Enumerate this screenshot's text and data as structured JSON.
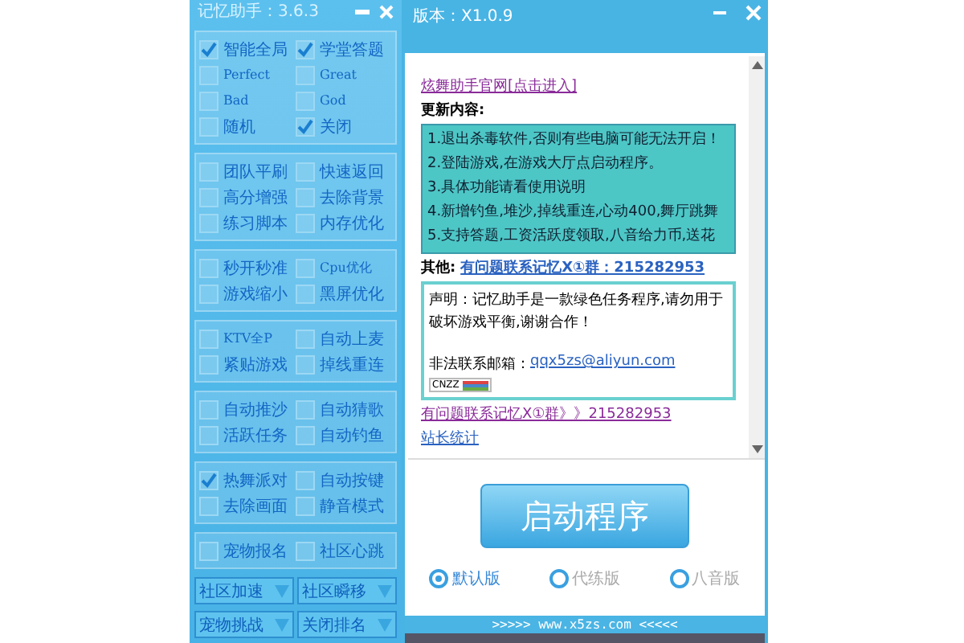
{
  "helper_panel": {
    "title": "记忆助手：3.6.3",
    "sections": [
      {
        "items": [
          {
            "label": "智能全局",
            "checked": true
          },
          {
            "label": "学堂答题",
            "checked": true
          },
          {
            "label": "Perfect",
            "checked": false
          },
          {
            "label": "Great",
            "checked": false
          },
          {
            "label": "Bad",
            "checked": false
          },
          {
            "label": "God",
            "checked": false
          },
          {
            "label": "随机",
            "checked": false
          },
          {
            "label": "关闭",
            "checked": true
          }
        ]
      },
      {
        "items": [
          {
            "label": "团队平刷",
            "checked": false
          },
          {
            "label": "快速返回",
            "checked": false
          },
          {
            "label": "高分增强",
            "checked": false
          },
          {
            "label": "去除背景",
            "checked": false
          },
          {
            "label": "练习脚本",
            "checked": false
          },
          {
            "label": "内存优化",
            "checked": false
          }
        ]
      },
      {
        "items": [
          {
            "label": "秒开秒准",
            "checked": false
          },
          {
            "label": "Cpu优化",
            "checked": false
          },
          {
            "label": "游戏缩小",
            "checked": false
          },
          {
            "label": "黑屏优化",
            "checked": false
          }
        ]
      },
      {
        "items": [
          {
            "label": "KTV全P",
            "checked": false
          },
          {
            "label": "自动上麦",
            "checked": false
          },
          {
            "label": "紧贴游戏",
            "checked": false
          },
          {
            "label": "掉线重连",
            "checked": false
          }
        ]
      },
      {
        "items": [
          {
            "label": "自动推沙",
            "checked": false
          },
          {
            "label": "自动猜歌",
            "checked": false
          },
          {
            "label": "活跃任务",
            "checked": false
          },
          {
            "label": "自动钓鱼",
            "checked": false
          }
        ]
      },
      {
        "items": [
          {
            "label": "热舞派对",
            "checked": true
          },
          {
            "label": "自动按键",
            "checked": false
          },
          {
            "label": "去除画面",
            "checked": false
          },
          {
            "label": "静音模式",
            "checked": false
          }
        ]
      },
      {
        "items": [
          {
            "label": "宠物报名",
            "checked": false
          },
          {
            "label": "社区心跳",
            "checked": false
          }
        ]
      }
    ],
    "dropdowns": [
      {
        "label": "社区加速"
      },
      {
        "label": "社区瞬移"
      },
      {
        "label": "宠物挑战"
      },
      {
        "label": "关闭排名"
      }
    ]
  },
  "main_window": {
    "title": "版本：X1.0.9",
    "site_link": "炫舞助手官网[点击进入]",
    "heading": "更新内容:",
    "updates": [
      "1.退出杀毒软件,否则有些电脑可能无法开启！",
      "2.登陆游戏,在游戏大厅点启动程序。",
      "3.具体功能请看使用说明",
      "4.新增钓鱼,堆沙,掉线重连,心动400,舞厅跳舞",
      "5.支持答题,工资活跃度领取,八音给力币,送花"
    ],
    "other_label": "其他:",
    "other_link": "有问题联系记忆X①群：215282953",
    "notice": "声明：记忆助手是一款绿色任务程序,请勿用于破坏游戏平衡,谢谢合作！",
    "email_label": "非法联系邮箱：",
    "email_link": "qqx5zs@aliyun.com",
    "badge": "CNZZ",
    "group_link": "有问题联系记忆X①群》》215282953",
    "stats_link": "站长统计",
    "start_button": "启动程序",
    "editions": [
      {
        "label": "默认版",
        "selected": true
      },
      {
        "label": "代练版",
        "selected": false
      },
      {
        "label": "八音版",
        "selected": false
      }
    ],
    "footer": ">>>>> www.x5zs.com <<<<<"
  }
}
